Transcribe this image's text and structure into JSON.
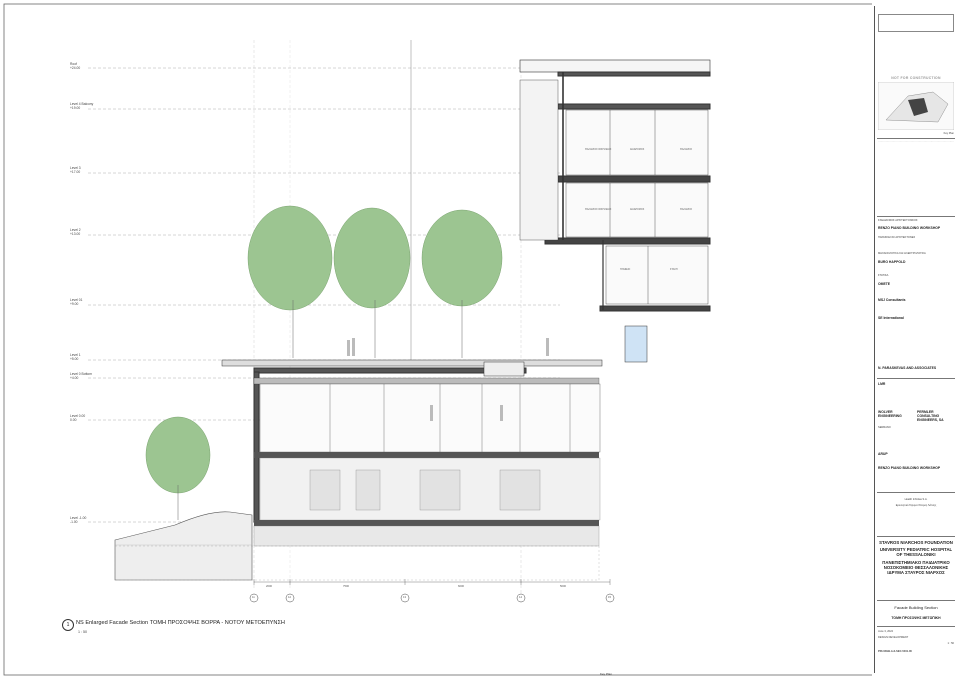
{
  "drawing": {
    "caption_number": "1",
    "caption": "NS Enlarged Facade Section ΤΟΜΗ ΠΡΟΣΟΨΗΣ ΒΟΡΡΑ - ΝΟΤΟΥ ΜΕΤΟΕΠΥΝΣΗ",
    "scale": "1 : 50",
    "levels": [
      {
        "label": "Roof",
        "value": "+24.00"
      },
      {
        "label": "Level 4 Balcony",
        "value": "+19.00"
      },
      {
        "label": "Level 3",
        "value": "+17.00"
      },
      {
        "label": "Level 2",
        "value": "+13.00"
      },
      {
        "label": "Level 01",
        "value": "+9.00"
      },
      {
        "label": "Level 1",
        "value": "+5.00"
      },
      {
        "label": "Level 0 Bottom",
        "value": "+4.00"
      },
      {
        "label": "Level 0.00",
        "value": "0.00"
      },
      {
        "label": "Level -1.00",
        "value": "-1.00"
      }
    ],
    "grid_labels": [
      "11",
      "12",
      "13",
      "14",
      "15"
    ],
    "dimensions": [
      "2000",
      "7500",
      "6000",
      "2400",
      "5000"
    ]
  },
  "title_block": {
    "not_for_construction": "NOT FOR CONSTRUCTION",
    "key_plan": "Key Plan",
    "consultants": [
      "ΣΧΕΔΙΑΣΜΟΣ ΑΡΧΙΤΕΚΤΟΝΙΚΟΣ",
      "RENZO PIANO BUILDING WORKSHOP",
      "ΠΑΡΑΣΚΕΥΑΣ ΑΡΧΙΤΕΚΤΟΝΕΣ",
      "ΜΗΧΑΝΟΛΟΓΙΚΑ ΚΑΙ ΗΛΕΚΤΡΟΛΟΓΙΚΑ",
      "BURO HAPPOLD",
      "ΣΤΑΤΙΚΑ",
      "OMETE",
      "MSJ Consultants",
      "SE International",
      "N. PARASKEVAS AND ASSOCIATES",
      "LMR",
      "WOLVER ENGINEERING",
      "PERMLER CONSULTING ENGINEERS, SA",
      "SERRANO",
      "ARUP",
      "RENZO PIANO BUILDING WORKSHOP"
    ],
    "client": "Health Infinitas S.A.",
    "client_gr": "Ερευνητικό Ίδρυμα Σπύρος Λάτσης",
    "foundation": "STAVROS NIARCHOS FOUNDATION",
    "project_en": "UNIVERSITY PEDIATRIC HOSPITAL OF THESSALONIKI",
    "project_gr": "ΠΑΝΕΠΙΣΤΗΜΙΑΚΟ ΠΑΙΔΙΑΤΡΙΚΟ ΝΟΣΟΚΟΜΕΙΟ ΘΕΣΣΑΛΟΝΙΚΗΣ ΙΔΡΥΜΑ ΣΤΑΥΡΟΣ ΝΙΑΡΧΟΣ",
    "sheet_title_en": "Facade Building Section",
    "sheet_title_gr": "ΤΟΜΗ ΠΡΟΣΟΨΗΣ ΜΕΤΩΠΙΚΗ",
    "phase": "DESIGN DEVELOPMENT",
    "scale": "1 : 50",
    "date": "June 3, 2024",
    "drawing_no": "PDU-RHB-A-X-SEC-5401-00",
    "footer": "Key Plan"
  }
}
